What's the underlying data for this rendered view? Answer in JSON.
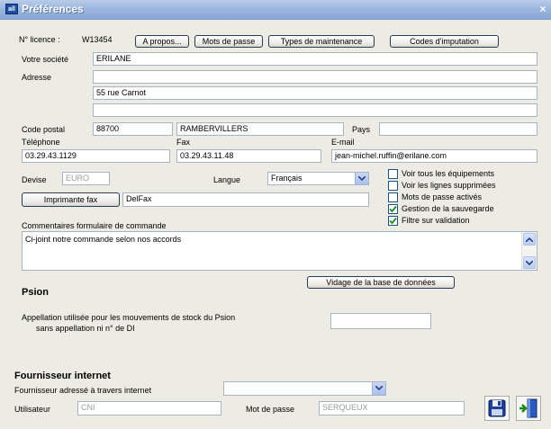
{
  "window": {
    "title": "Préférences",
    "icon_text": "all",
    "close_glyph": "×"
  },
  "licence": {
    "label": "N° licence :",
    "value": "W13454"
  },
  "buttons": {
    "apropos": "A propos...",
    "mots_de_passe": "Mots de passe",
    "types_maintenance": "Types de maintenance",
    "codes_imputation": "Codes d'imputation",
    "imprimante_fax": "Imprimante fax",
    "vidage": "Vidage de la base de données"
  },
  "societe": {
    "label": "Votre société",
    "value": "ERILANE"
  },
  "adresse": {
    "label": "Adresse",
    "line1": "",
    "line2": "55 rue Carnot",
    "line3": ""
  },
  "code_postal": {
    "label": "Code postal",
    "value": "88700"
  },
  "ville": {
    "value": "RAMBERVILLERS"
  },
  "pays": {
    "label": "Pays",
    "value": ""
  },
  "telephone": {
    "label": "Téléphone",
    "value": "03.29.43.1129"
  },
  "fax": {
    "label": "Fax",
    "value": "03.29.43.11.48"
  },
  "email": {
    "label": "E-mail",
    "value": "jean-michel.ruffin@erilane.com"
  },
  "devise": {
    "label": "Devise",
    "value": "EURO"
  },
  "langue": {
    "label": "Langue",
    "value": "Français"
  },
  "imprimante_fax_value": "DelFax",
  "options": [
    {
      "label": "Voir tous les équipements",
      "checked": false
    },
    {
      "label": "Voir les lignes supprimées",
      "checked": false
    },
    {
      "label": "Mots de passe activés",
      "checked": false
    },
    {
      "label": "Gestion de la sauvegarde",
      "checked": true
    },
    {
      "label": "Filtre sur validation",
      "checked": true
    }
  ],
  "commentaires": {
    "label": "Commentaires formulaire de commande",
    "value": "Ci-joint notre commande selon nos accords"
  },
  "psion": {
    "title": "Psion",
    "desc_line1": "Appellation utilisée pour les mouvements de stock du Psion",
    "desc_line2": "sans appellation ni n° de DI",
    "value": ""
  },
  "fournisseur": {
    "title": "Fournisseur internet",
    "adresse_label": "Fournisseur adressé à travers internet",
    "adresse_value": "",
    "utilisateur_label": "Utilisateur",
    "utilisateur_value": "CNI",
    "mdp_label": "Mot de passe",
    "mdp_value": "SERQUEUX"
  },
  "icons": {
    "save": "floppy-disk-icon",
    "exit": "exit-door-icon"
  }
}
